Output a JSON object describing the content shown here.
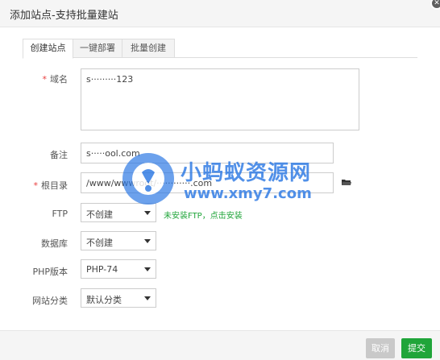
{
  "dialog": {
    "title": "添加站点-支持批量建站"
  },
  "tabs": [
    {
      "label": "创建站点",
      "active": true
    },
    {
      "label": "一键部署",
      "active": false
    },
    {
      "label": "批量创建",
      "active": false
    }
  ],
  "form": {
    "domain": {
      "label": "域名",
      "required": true,
      "value": "s·········123"
    },
    "remark": {
      "label": "备注",
      "value": "s·····ool.com"
    },
    "root": {
      "label": "根目录",
      "required": true,
      "value": "/www/wwwroot/············.com"
    },
    "ftp": {
      "label": "FTP",
      "value": "不创建",
      "hint": "未安装FTP，点击安装"
    },
    "database": {
      "label": "数据库",
      "value": "不创建"
    },
    "php": {
      "label": "PHP版本",
      "value": "PHP-74"
    },
    "category": {
      "label": "网站分类",
      "value": "默认分类"
    }
  },
  "watermark": {
    "name": "小蚂蚁资源网",
    "url": "www.xmy7.com"
  },
  "footer": {
    "cancel": "取消",
    "submit": "提交"
  },
  "colors": {
    "accent": "#20a53a",
    "required": "#e83e3e",
    "watermark": "#2b78e4"
  }
}
